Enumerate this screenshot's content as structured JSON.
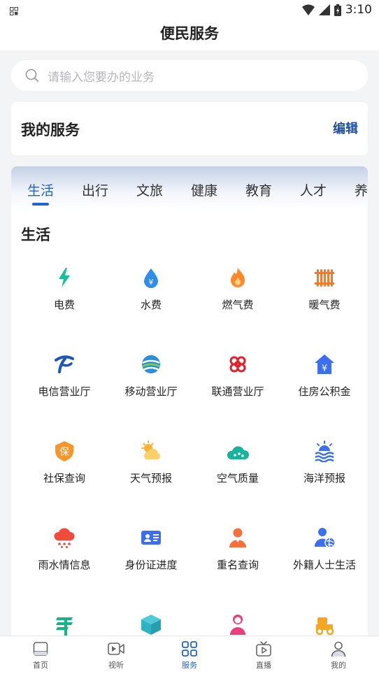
{
  "status_bar": {
    "time": "3:10"
  },
  "header": {
    "title": "便民服务"
  },
  "search": {
    "placeholder": "请输入您要办的业务"
  },
  "my_services": {
    "title": "我的服务",
    "edit_label": "编辑"
  },
  "category_tabs": [
    "生活",
    "出行",
    "文旅",
    "健康",
    "教育",
    "人才",
    "养"
  ],
  "section": {
    "title": "生活",
    "items": [
      {
        "label": "电费",
        "icon": "lightning-icon"
      },
      {
        "label": "水费",
        "icon": "water-drop-icon"
      },
      {
        "label": "燃气费",
        "icon": "flame-icon"
      },
      {
        "label": "暖气费",
        "icon": "radiator-icon"
      },
      {
        "label": "电信营业厅",
        "icon": "china-telecom-icon"
      },
      {
        "label": "移动营业厅",
        "icon": "china-mobile-icon"
      },
      {
        "label": "联通营业厅",
        "icon": "china-unicom-icon"
      },
      {
        "label": "住房公积金",
        "icon": "house-fund-icon"
      },
      {
        "label": "社保查询",
        "icon": "social-security-icon"
      },
      {
        "label": "天气预报",
        "icon": "weather-icon"
      },
      {
        "label": "空气质量",
        "icon": "air-quality-icon"
      },
      {
        "label": "海洋预报",
        "icon": "ocean-icon"
      },
      {
        "label": "雨水情信息",
        "icon": "rain-icon"
      },
      {
        "label": "身份证进度",
        "icon": "id-card-icon"
      },
      {
        "label": "重名查询",
        "icon": "person-icon"
      },
      {
        "label": "外籍人士生活",
        "icon": "foreigner-icon"
      }
    ]
  },
  "bottom_nav": [
    "首页",
    "视听",
    "服务",
    "直播",
    "我的"
  ],
  "colors": {
    "accent": "#1e63d6",
    "edit": "#1e4fa6"
  }
}
